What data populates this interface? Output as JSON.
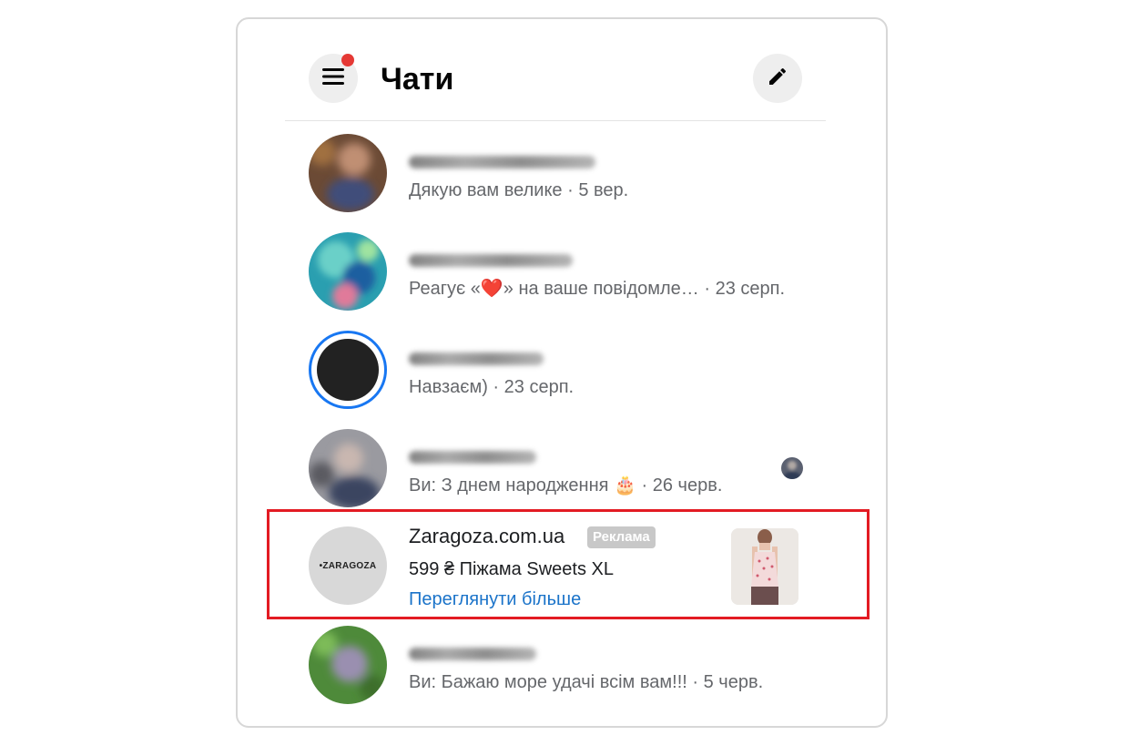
{
  "header": {
    "title": "Чати"
  },
  "icons": {
    "menu": "hamburger-menu-icon",
    "compose": "pencil-icon"
  },
  "colors": {
    "notification_dot": "#e53935",
    "link": "#1a73c9",
    "ad_highlight": "#e31b23",
    "story_ring": "#1877f2"
  },
  "chats": [
    {
      "name": "",
      "name_blurred": true,
      "preview": "Дякую вам велике",
      "time": "5 вер."
    },
    {
      "name": "",
      "name_blurred": true,
      "preview": "Реагує «❤️» на ваше повідомле…",
      "time": "23 серп."
    },
    {
      "name": "",
      "name_blurred": true,
      "preview": "Навзаєм)",
      "time": "23 серп.",
      "has_story_ring": true
    },
    {
      "name": "",
      "name_blurred": true,
      "preview": "Ви: З днем народження 🎂",
      "time": "26 черв.",
      "seen_by_avatar": true
    },
    {
      "name": "",
      "name_blurred": true,
      "preview": "Ви: Бажаю море удачі всім вам!!!",
      "time": "5 черв."
    }
  ],
  "ad": {
    "name": "Zaragoza.com.ua",
    "badge": "Реклама",
    "product": "599 ₴  Піжама Sweets XL",
    "link": "Переглянути більше",
    "logo_text": "•ZARAGOZA"
  }
}
